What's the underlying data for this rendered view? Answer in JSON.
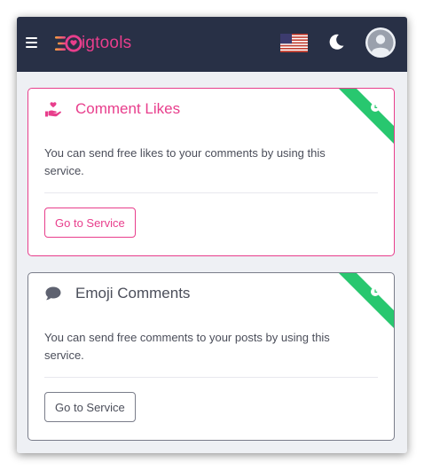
{
  "header": {
    "logo_text": "igtools",
    "language": "en-US",
    "icons": [
      "menu-icon",
      "us-flag-icon",
      "moon-icon",
      "user-avatar-icon"
    ]
  },
  "colors": {
    "navbar": "#283046",
    "accent": "#e83e8c",
    "ribbon": "#28c76f",
    "muted": "#7a7d8a"
  },
  "services": [
    {
      "title": "Comment Likes",
      "description": "You can send free likes to your comments by using this service.",
      "button_label": "Go to Service",
      "icon": "hand-heart-icon",
      "ribbon_icon": "clock-icon"
    },
    {
      "title": "Emoji Comments",
      "description": "You can send free comments to your posts by using this service.",
      "button_label": "Go to Service",
      "icon": "comment-icon",
      "ribbon_icon": "clock-icon"
    }
  ]
}
